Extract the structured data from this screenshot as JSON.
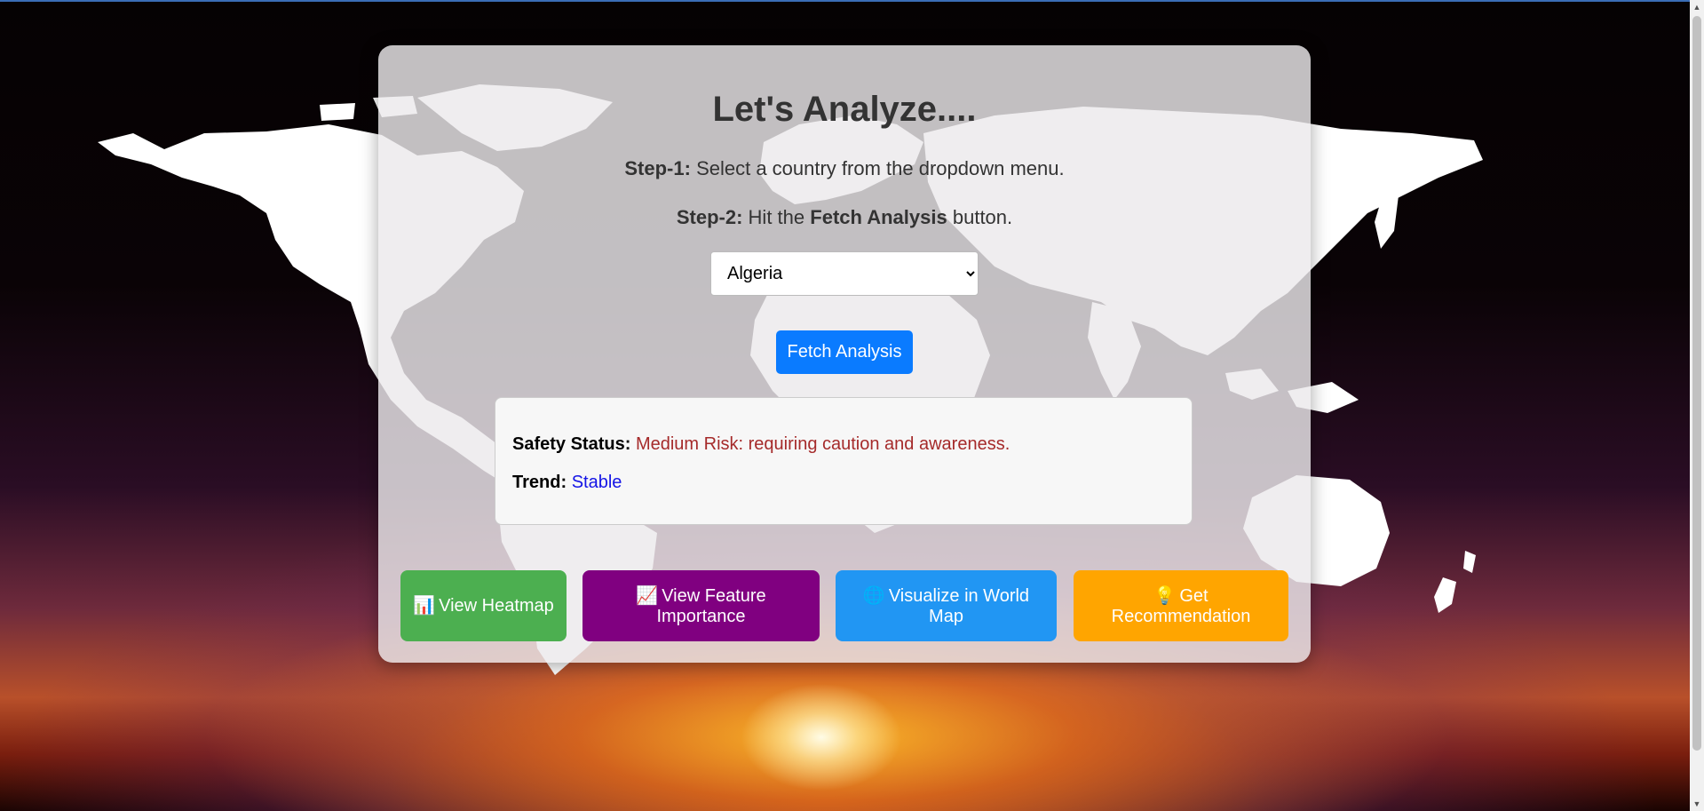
{
  "page": {
    "title": "Let's Analyze....",
    "step1": {
      "label": "Step-1:",
      "text": "Select a country from the dropdown menu."
    },
    "step2": {
      "label": "Step-2:",
      "text_before": "Hit the",
      "emphasis": "Fetch Analysis",
      "text_after": "button."
    }
  },
  "country_select": {
    "selected": "Algeria"
  },
  "fetch_button": {
    "label": "Fetch Analysis"
  },
  "result": {
    "safety_label": "Safety Status:",
    "safety_value": "Medium Risk: requiring caution and awareness.",
    "trend_label": "Trend:",
    "trend_value": "Stable"
  },
  "actions": {
    "heatmap": {
      "icon": "📊",
      "label": "View Heatmap"
    },
    "feature": {
      "icon": "📈",
      "label": "View Feature Importance"
    },
    "world_map": {
      "icon": "🌐",
      "label": "Visualize in World Map"
    },
    "recommend": {
      "icon": "💡",
      "label": "Get Recommendation"
    }
  },
  "colors": {
    "fetch": "#0a7bff",
    "heatmap": "#4caf50",
    "feature": "#800080",
    "world_map": "#2196f3",
    "recommend": "#ffa500",
    "safety_value": "#a52a2a",
    "trend_value": "#1414e6"
  }
}
